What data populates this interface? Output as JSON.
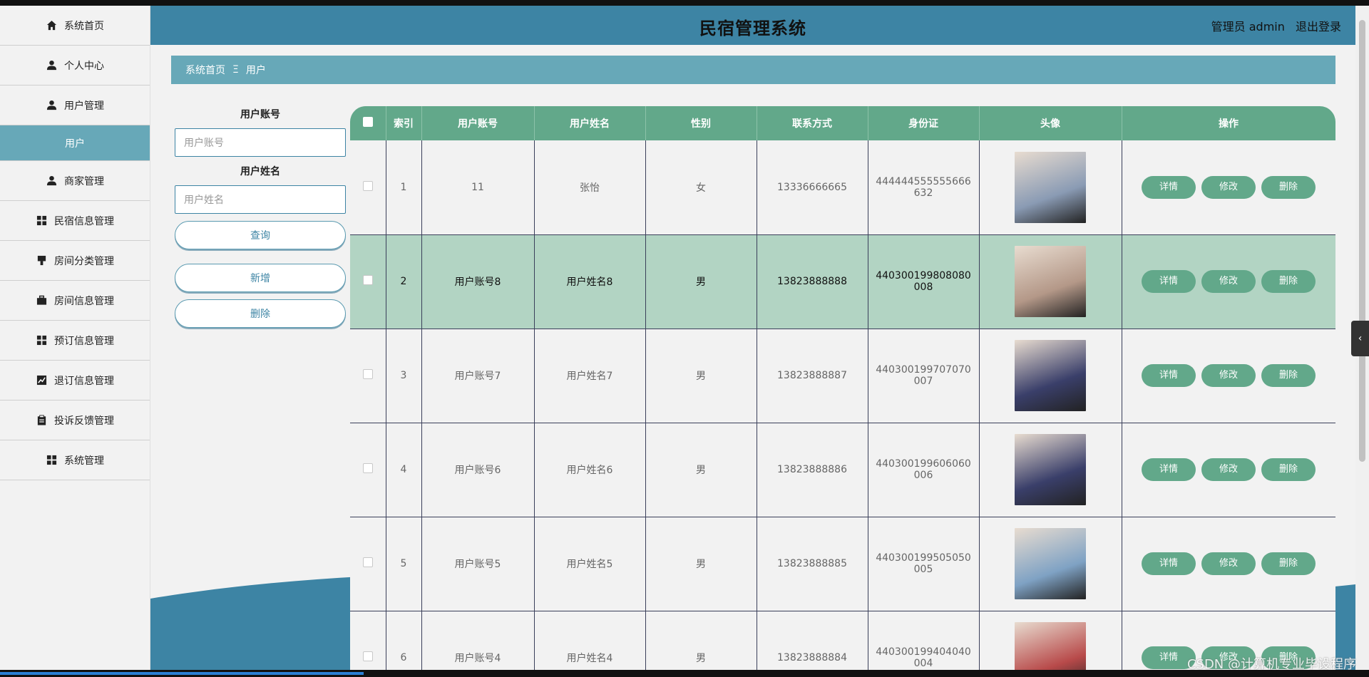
{
  "app": {
    "title": "民宿管理系统"
  },
  "header": {
    "user_label": "管理员 admin",
    "logout": "退出登录"
  },
  "sidebar": {
    "items": [
      {
        "label": "系统首页",
        "icon": "home-icon"
      },
      {
        "label": "个人中心",
        "icon": "user-icon"
      },
      {
        "label": "用户管理",
        "icon": "user-icon"
      },
      {
        "label": "用户",
        "icon": "",
        "active": true
      },
      {
        "label": "商家管理",
        "icon": "user-icon"
      },
      {
        "label": "民宿信息管理",
        "icon": "grid-icon"
      },
      {
        "label": "房间分类管理",
        "icon": "flag-icon"
      },
      {
        "label": "房间信息管理",
        "icon": "briefcase-icon"
      },
      {
        "label": "预订信息管理",
        "icon": "grid-icon"
      },
      {
        "label": "退订信息管理",
        "icon": "chart-icon"
      },
      {
        "label": "投诉反馈管理",
        "icon": "clipboard-icon"
      },
      {
        "label": "系统管理",
        "icon": "grid-icon"
      }
    ]
  },
  "breadcrumb": {
    "home": "系统首页",
    "sep": "Ξ",
    "current": "用户"
  },
  "search": {
    "account_label": "用户账号",
    "account_placeholder": "用户账号",
    "name_label": "用户姓名",
    "name_placeholder": "用户姓名",
    "query_button": "查询",
    "add_button": "新增",
    "delete_button": "删除"
  },
  "table": {
    "headers": [
      "索引",
      "用户账号",
      "用户姓名",
      "性别",
      "联系方式",
      "身份证",
      "头像",
      "操作"
    ],
    "actions": {
      "detail": "详情",
      "edit": "修改",
      "delete": "删除"
    },
    "rows": [
      {
        "index": "1",
        "account": "11",
        "name": "张怡",
        "gender": "女",
        "phone": "13336666665",
        "id_card": "444444555555666632",
        "avatar_color": "#8a9bb4"
      },
      {
        "index": "2",
        "account": "用户账号8",
        "name": "用户姓名8",
        "gender": "男",
        "phone": "13823888888",
        "id_card": "440300199808080008",
        "avatar_color": "#b49888",
        "highlight": true
      },
      {
        "index": "3",
        "account": "用户账号7",
        "name": "用户姓名7",
        "gender": "男",
        "phone": "13823888887",
        "id_card": "440300199707070007",
        "avatar_color": "#3a3f6a"
      },
      {
        "index": "4",
        "account": "用户账号6",
        "name": "用户姓名6",
        "gender": "男",
        "phone": "13823888886",
        "id_card": "440300199606060006",
        "avatar_color": "#3a3f6a"
      },
      {
        "index": "5",
        "account": "用户账号5",
        "name": "用户姓名5",
        "gender": "男",
        "phone": "13823888885",
        "id_card": "440300199505050005",
        "avatar_color": "#7fa2c4"
      },
      {
        "index": "6",
        "account": "用户账号4",
        "name": "用户姓名4",
        "gender": "男",
        "phone": "13823888884",
        "id_card": "440300199404040004",
        "avatar_color": "#b84a4a"
      }
    ]
  },
  "watermark": "CSDN @计算机专业毕设程序",
  "colors": {
    "header": "#3d84a4",
    "accent": "#67a8b8",
    "table_header": "#62a88a",
    "highlight_row": "#b2d4c3"
  }
}
